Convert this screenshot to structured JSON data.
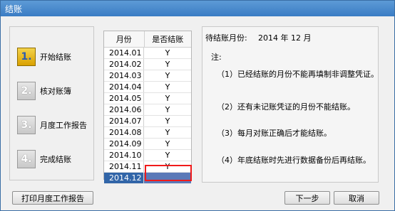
{
  "window": {
    "title": "结账"
  },
  "steps": [
    {
      "num": "1.",
      "label": "开始结账"
    },
    {
      "num": "2.",
      "label": "核对账簿"
    },
    {
      "num": "3.",
      "label": "月度工作报告"
    },
    {
      "num": "4.",
      "label": "完成结账"
    }
  ],
  "table": {
    "headers": {
      "month": "月份",
      "status": "是否结账"
    },
    "rows": [
      {
        "month": "2014.01",
        "status": "Y"
      },
      {
        "month": "2014.02",
        "status": "Y"
      },
      {
        "month": "2014.03",
        "status": "Y"
      },
      {
        "month": "2014.04",
        "status": "Y"
      },
      {
        "month": "2014.05",
        "status": "Y"
      },
      {
        "month": "2014.06",
        "status": "Y"
      },
      {
        "month": "2014.07",
        "status": "Y"
      },
      {
        "month": "2014.08",
        "status": "Y"
      },
      {
        "month": "2014.09",
        "status": "Y"
      },
      {
        "month": "2014.10",
        "status": "Y"
      },
      {
        "month": "2014.11",
        "status": "Y"
      },
      {
        "month": "2014.12",
        "status": ""
      }
    ]
  },
  "info": {
    "pending_label": "待结账月份:",
    "pending_value": "2014 年 12 月",
    "note_title": "注:",
    "notes": [
      "（1）已经结账的月份不能再填制非调整凭证。",
      "（2）还有未记账凭证的月份不能结账。",
      "（3）每月对账正确后才能结账。",
      "（4）年底结账时先进行数据备份后再结账。"
    ]
  },
  "buttons": {
    "print": "打印月度工作报告",
    "next": "下一步",
    "cancel": "取消"
  },
  "colors": {
    "title_bar": "#3a7cc4",
    "selected_row": "#3165a8",
    "highlight": "#f01a1a"
  }
}
